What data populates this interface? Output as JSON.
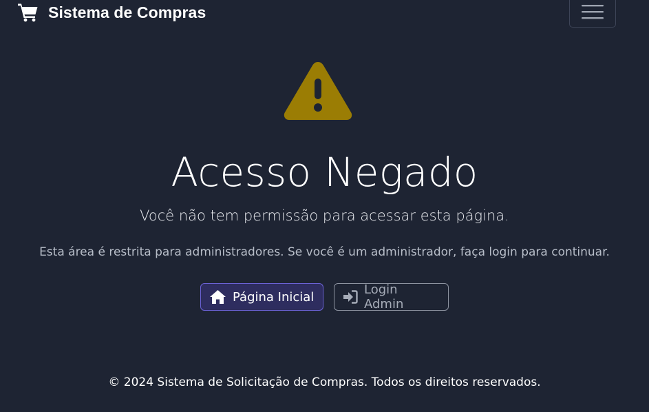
{
  "navbar": {
    "brand_icon": "shopping-cart-icon",
    "brand_text": "Sistema de Compras",
    "toggler_icon": "hamburger-menu-icon"
  },
  "main": {
    "icon": "warning-triangle-icon",
    "icon_color": "#9b7d04",
    "title": "Acesso Negado",
    "lead": "Você não tem permissão para acessar esta página.",
    "message": "Esta área é restrita para administradores. Se você é um administrador, faça login para continuar.",
    "buttons": {
      "home": {
        "label": "Página Inicial",
        "icon": "home-icon",
        "accent": "#6b62d6"
      },
      "admin_login": {
        "label": "Login Admin",
        "icon": "sign-in-icon"
      }
    }
  },
  "footer": {
    "text": "© 2024 Sistema de Solicitação de Compras. Todos os direitos reservados."
  },
  "colors": {
    "background": "#1e2433"
  }
}
